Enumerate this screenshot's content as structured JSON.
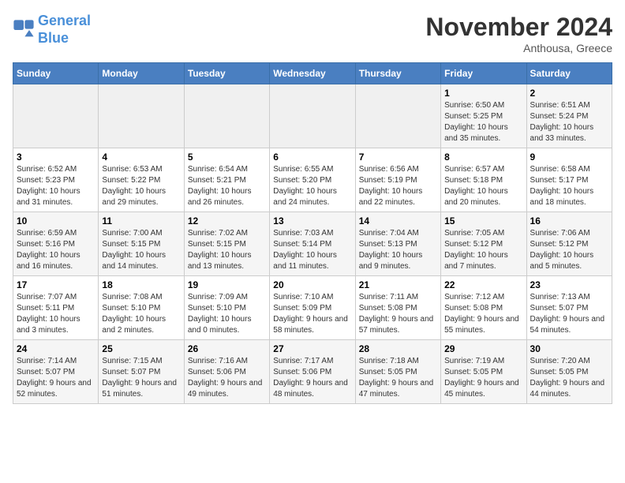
{
  "logo": {
    "line1": "General",
    "line2": "Blue"
  },
  "title": "November 2024",
  "location": "Anthousa, Greece",
  "weekdays": [
    "Sunday",
    "Monday",
    "Tuesday",
    "Wednesday",
    "Thursday",
    "Friday",
    "Saturday"
  ],
  "weeks": [
    [
      {
        "day": "",
        "info": ""
      },
      {
        "day": "",
        "info": ""
      },
      {
        "day": "",
        "info": ""
      },
      {
        "day": "",
        "info": ""
      },
      {
        "day": "",
        "info": ""
      },
      {
        "day": "1",
        "info": "Sunrise: 6:50 AM\nSunset: 5:25 PM\nDaylight: 10 hours and 35 minutes."
      },
      {
        "day": "2",
        "info": "Sunrise: 6:51 AM\nSunset: 5:24 PM\nDaylight: 10 hours and 33 minutes."
      }
    ],
    [
      {
        "day": "3",
        "info": "Sunrise: 6:52 AM\nSunset: 5:23 PM\nDaylight: 10 hours and 31 minutes."
      },
      {
        "day": "4",
        "info": "Sunrise: 6:53 AM\nSunset: 5:22 PM\nDaylight: 10 hours and 29 minutes."
      },
      {
        "day": "5",
        "info": "Sunrise: 6:54 AM\nSunset: 5:21 PM\nDaylight: 10 hours and 26 minutes."
      },
      {
        "day": "6",
        "info": "Sunrise: 6:55 AM\nSunset: 5:20 PM\nDaylight: 10 hours and 24 minutes."
      },
      {
        "day": "7",
        "info": "Sunrise: 6:56 AM\nSunset: 5:19 PM\nDaylight: 10 hours and 22 minutes."
      },
      {
        "day": "8",
        "info": "Sunrise: 6:57 AM\nSunset: 5:18 PM\nDaylight: 10 hours and 20 minutes."
      },
      {
        "day": "9",
        "info": "Sunrise: 6:58 AM\nSunset: 5:17 PM\nDaylight: 10 hours and 18 minutes."
      }
    ],
    [
      {
        "day": "10",
        "info": "Sunrise: 6:59 AM\nSunset: 5:16 PM\nDaylight: 10 hours and 16 minutes."
      },
      {
        "day": "11",
        "info": "Sunrise: 7:00 AM\nSunset: 5:15 PM\nDaylight: 10 hours and 14 minutes."
      },
      {
        "day": "12",
        "info": "Sunrise: 7:02 AM\nSunset: 5:15 PM\nDaylight: 10 hours and 13 minutes."
      },
      {
        "day": "13",
        "info": "Sunrise: 7:03 AM\nSunset: 5:14 PM\nDaylight: 10 hours and 11 minutes."
      },
      {
        "day": "14",
        "info": "Sunrise: 7:04 AM\nSunset: 5:13 PM\nDaylight: 10 hours and 9 minutes."
      },
      {
        "day": "15",
        "info": "Sunrise: 7:05 AM\nSunset: 5:12 PM\nDaylight: 10 hours and 7 minutes."
      },
      {
        "day": "16",
        "info": "Sunrise: 7:06 AM\nSunset: 5:12 PM\nDaylight: 10 hours and 5 minutes."
      }
    ],
    [
      {
        "day": "17",
        "info": "Sunrise: 7:07 AM\nSunset: 5:11 PM\nDaylight: 10 hours and 3 minutes."
      },
      {
        "day": "18",
        "info": "Sunrise: 7:08 AM\nSunset: 5:10 PM\nDaylight: 10 hours and 2 minutes."
      },
      {
        "day": "19",
        "info": "Sunrise: 7:09 AM\nSunset: 5:10 PM\nDaylight: 10 hours and 0 minutes."
      },
      {
        "day": "20",
        "info": "Sunrise: 7:10 AM\nSunset: 5:09 PM\nDaylight: 9 hours and 58 minutes."
      },
      {
        "day": "21",
        "info": "Sunrise: 7:11 AM\nSunset: 5:08 PM\nDaylight: 9 hours and 57 minutes."
      },
      {
        "day": "22",
        "info": "Sunrise: 7:12 AM\nSunset: 5:08 PM\nDaylight: 9 hours and 55 minutes."
      },
      {
        "day": "23",
        "info": "Sunrise: 7:13 AM\nSunset: 5:07 PM\nDaylight: 9 hours and 54 minutes."
      }
    ],
    [
      {
        "day": "24",
        "info": "Sunrise: 7:14 AM\nSunset: 5:07 PM\nDaylight: 9 hours and 52 minutes."
      },
      {
        "day": "25",
        "info": "Sunrise: 7:15 AM\nSunset: 5:07 PM\nDaylight: 9 hours and 51 minutes."
      },
      {
        "day": "26",
        "info": "Sunrise: 7:16 AM\nSunset: 5:06 PM\nDaylight: 9 hours and 49 minutes."
      },
      {
        "day": "27",
        "info": "Sunrise: 7:17 AM\nSunset: 5:06 PM\nDaylight: 9 hours and 48 minutes."
      },
      {
        "day": "28",
        "info": "Sunrise: 7:18 AM\nSunset: 5:05 PM\nDaylight: 9 hours and 47 minutes."
      },
      {
        "day": "29",
        "info": "Sunrise: 7:19 AM\nSunset: 5:05 PM\nDaylight: 9 hours and 45 minutes."
      },
      {
        "day": "30",
        "info": "Sunrise: 7:20 AM\nSunset: 5:05 PM\nDaylight: 9 hours and 44 minutes."
      }
    ]
  ]
}
